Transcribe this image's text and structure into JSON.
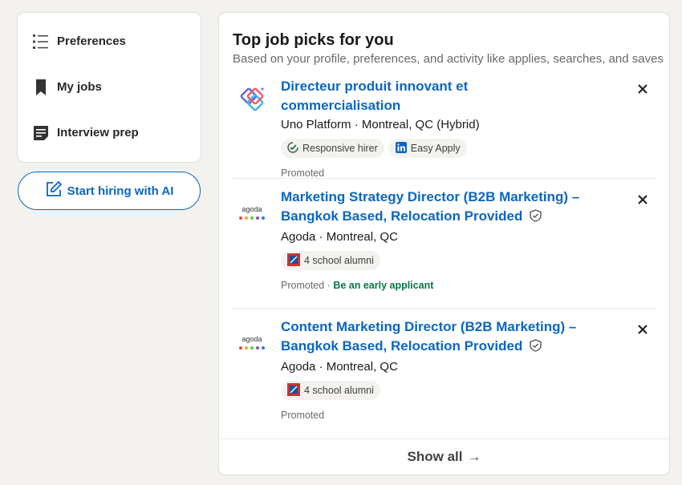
{
  "sidebar": {
    "items": [
      {
        "label": "Preferences",
        "icon": "list-icon"
      },
      {
        "label": "My jobs",
        "icon": "bookmark-icon"
      },
      {
        "label": "Interview prep",
        "icon": "notes-icon"
      }
    ],
    "hire_button": {
      "label": "Start hiring with AI",
      "icon": "compose-icon"
    }
  },
  "main": {
    "title": "Top job picks for you",
    "subtitle": "Based on your profile, preferences, and activity like applies, searches, and saves",
    "jobs": [
      {
        "title": "Directeur produit innovant et commercialisation",
        "company": "Uno Platform · Montreal, QC (Hybrid)",
        "badges": [
          "Responsive hirer",
          "Easy Apply"
        ],
        "promoted": "Promoted"
      },
      {
        "title": "Marketing Strategy Director (B2B Marketing) – Bangkok Based, Relocation Provided",
        "company": "Agoda · Montreal, QC",
        "badges": [
          "4 school alumni"
        ],
        "promoted": "Promoted",
        "separator": " · ",
        "extra": "Be an early applicant"
      },
      {
        "title": "Content Marketing Director (B2B Marketing) – Bangkok Based, Relocation Provided",
        "company": "Agoda · Montreal, QC",
        "badges": [
          "4 school alumni"
        ],
        "promoted": "Promoted"
      }
    ],
    "agoda_logo_text": "agoda",
    "show_all": "Show all",
    "show_all_arrow": "→"
  },
  "colors": {
    "link": "#0a66c2",
    "early_applicant": "#057642",
    "background": "#f4f2ee"
  }
}
